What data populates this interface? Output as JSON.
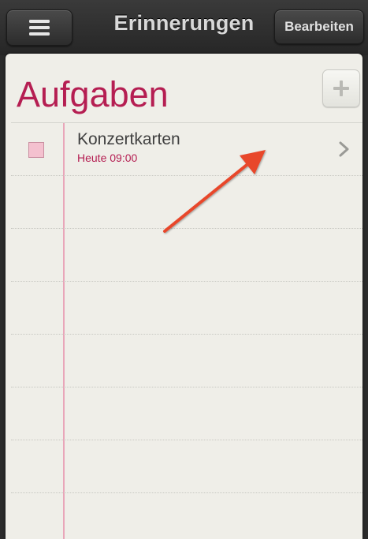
{
  "header": {
    "title": "Erinnerungen",
    "edit_label": "Bearbeiten",
    "menu_icon": "menu-icon"
  },
  "list": {
    "title": "Aufgaben",
    "add_icon": "plus-icon"
  },
  "tasks": [
    {
      "title": "Konzertkarten",
      "due": "Heute 09:00",
      "completed": false
    }
  ],
  "colors": {
    "accent": "#b51e52",
    "paper": "#efeee8",
    "checkbox": "#f4c1cf",
    "annotation_arrow": "#e8462c"
  }
}
